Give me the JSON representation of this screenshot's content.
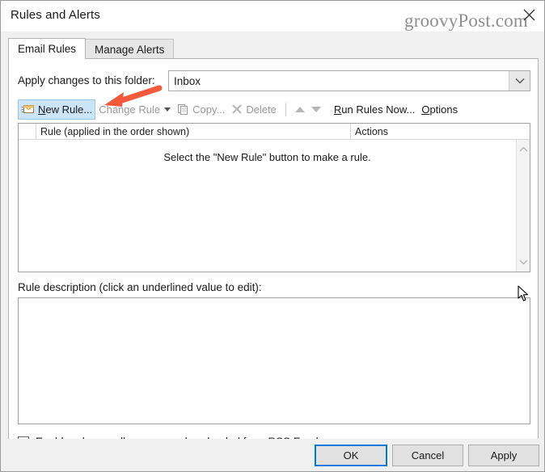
{
  "window": {
    "title": "Rules and Alerts",
    "watermark": "groovyPost.com",
    "close_icon": "close-icon"
  },
  "tabs": [
    {
      "label": "Email Rules",
      "active": true
    },
    {
      "label": "Manage Alerts",
      "active": false
    }
  ],
  "folder": {
    "label": "Apply changes to this folder:",
    "selected": "Inbox",
    "dropdown_icon": "chevron-down-icon"
  },
  "toolbar": {
    "new_rule": "New Rule...",
    "change_rule": "Change Rule",
    "copy": "Copy...",
    "delete": "Delete",
    "move_up_icon": "arrow-up-icon",
    "move_down_icon": "arrow-down-icon",
    "run_rules_now": "Run Rules Now...",
    "options": "Options"
  },
  "rules_list": {
    "columns": [
      "Rule (applied in the order shown)",
      "Actions"
    ],
    "rows": [],
    "empty_message": "Select the \"New Rule\" button to make a rule.",
    "scroll_up_icon": "chevron-up-icon",
    "scroll_down_icon": "chevron-down-icon"
  },
  "description": {
    "label": "Rule description (click an underlined value to edit):",
    "value": ""
  },
  "rss_checkbox": {
    "label": "Enable rules on all messages downloaded from RSS Feeds",
    "checked": false
  },
  "footer": {
    "ok": "OK",
    "cancel": "Cancel",
    "apply": "Apply"
  },
  "annotation": {
    "arrow_color": "#f4593c",
    "points_to": "New Rule..."
  },
  "colors": {
    "accent": "#0078d7",
    "highlight": "#cce4f7",
    "panel": "#f0f0f0"
  }
}
